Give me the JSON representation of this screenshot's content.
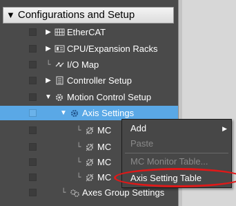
{
  "section": {
    "title": "Configurations and Setup",
    "expanded": true
  },
  "tree": [
    {
      "label": "EtherCAT",
      "icon": "ethercat-icon"
    },
    {
      "label": "CPU/Expansion Racks",
      "icon": "rack-icon"
    },
    {
      "label": "I/O Map",
      "icon": "io-map-icon"
    },
    {
      "label": "Controller Setup",
      "icon": "controller-icon"
    },
    {
      "label": "Motion Control Setup",
      "icon": "gear-icon"
    },
    {
      "label": "Axis Settings",
      "icon": "gear-icon",
      "selected": true
    },
    {
      "label": "MC",
      "icon": "axis-gear-icon"
    },
    {
      "label": "MC",
      "icon": "axis-gear-icon"
    },
    {
      "label": "MC",
      "icon": "axis-gear-icon"
    },
    {
      "label": "MC",
      "icon": "axis-gear-icon"
    },
    {
      "label": "Axes Group Settings",
      "icon": "axes-group-icon"
    }
  ],
  "context_menu": {
    "items": [
      {
        "label": "Add",
        "enabled": true,
        "submenu": true
      },
      {
        "label": "Paste",
        "enabled": false
      },
      {
        "label": "MC Monitor Table...",
        "enabled": false
      },
      {
        "label": "Axis Setting Table",
        "enabled": true,
        "highlighted": true
      }
    ]
  },
  "colors": {
    "selection": "#5aa8e6",
    "annotation_ring": "#e01818",
    "panel_bg": "#4a4a4a"
  }
}
